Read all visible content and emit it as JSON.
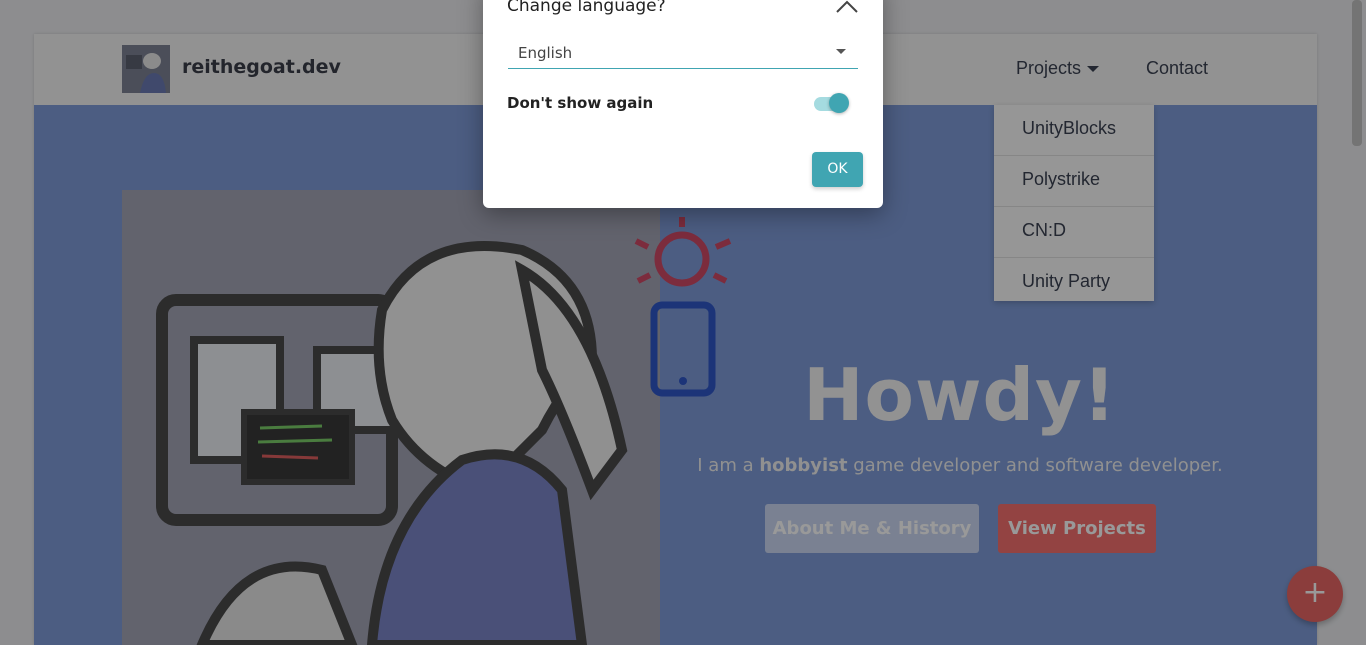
{
  "site": {
    "brand_name": "reithegoat.dev"
  },
  "nav": {
    "projects_label": "Projects",
    "contact_label": "Contact",
    "projects_menu": [
      "UnityBlocks",
      "Polystrike",
      "CN:D",
      "Unity Party"
    ]
  },
  "hero": {
    "title": "Howdy!",
    "subtitle_prefix": "I am a ",
    "subtitle_bold": "hobbyist",
    "subtitle_suffix": " game developer and software developer.",
    "about_button": "About Me & History",
    "projects_button": "View Projects"
  },
  "fab": {
    "label": "+"
  },
  "modal": {
    "title": "Change language?",
    "language_value": "English",
    "dont_show_label": "Don't show again",
    "dont_show_checked": true,
    "ok_label": "OK"
  },
  "colors": {
    "accent": "#40a5b2",
    "hero_bg": "#7f9cd9",
    "projects_button": "#f5716e",
    "about_button": "#cbd8f3",
    "fab": "#e86764"
  }
}
